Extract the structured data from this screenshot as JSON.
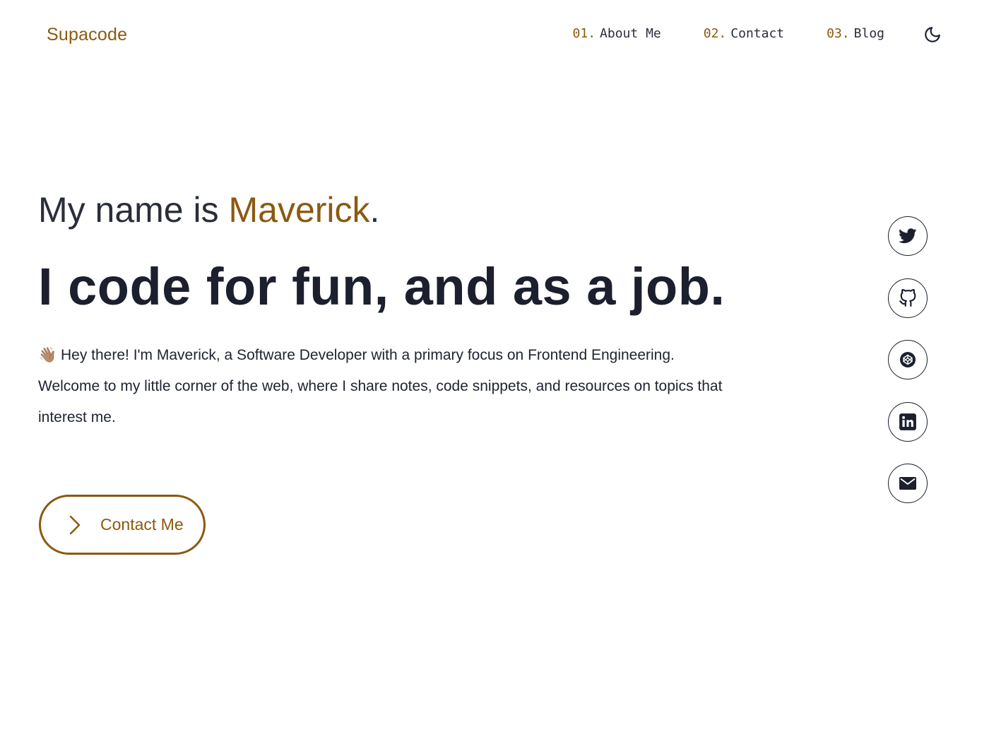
{
  "header": {
    "logo": "Supacode",
    "nav": [
      {
        "num": "01.",
        "label": "About Me"
      },
      {
        "num": "02.",
        "label": "Contact"
      },
      {
        "num": "03.",
        "label": "Blog"
      }
    ],
    "theme_toggle_icon": "moon-icon"
  },
  "hero": {
    "intro_prefix": "My name is ",
    "name": "Maverick",
    "intro_suffix": ".",
    "headline": "I code for fun, and as a job.",
    "bio_line1": "👋🏽 Hey there! I'm Maverick, a Software Developer with a primary focus on Frontend Engineering.",
    "bio_line2": "Welcome to my little corner of the web, where I share notes, code snippets, and resources on topics that interest me.",
    "cta_label": "Contact Me",
    "cta_icon": "chevron-right-icon"
  },
  "social": [
    {
      "icon": "twitter-icon"
    },
    {
      "icon": "github-icon"
    },
    {
      "icon": "codepen-icon"
    },
    {
      "icon": "linkedin-icon"
    },
    {
      "icon": "mail-icon"
    }
  ],
  "colors": {
    "accent": "#8b5a10",
    "text": "#1b1f2e",
    "background": "#ffffff"
  }
}
